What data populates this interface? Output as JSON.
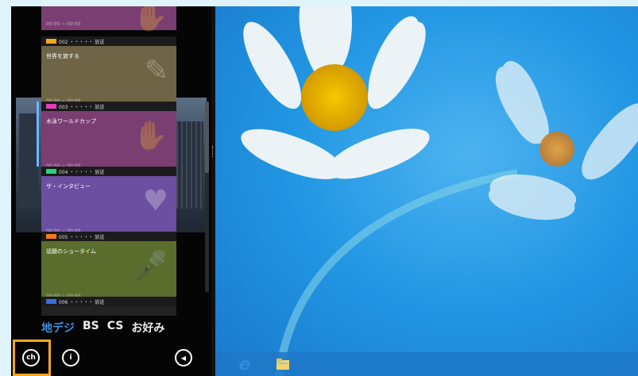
{
  "programs": [
    {
      "ch": "002 ・・・・・ 放送",
      "title": "世界を旅する",
      "time": "00:00 ~ 00:00",
      "chip": "#f5a623",
      "bg": "#6f6445",
      "glyph": "✎"
    },
    {
      "ch": "003 ・・・・・ 放送",
      "title": "水泳ワールドカップ",
      "time": "00:00 ~ 00:00",
      "chip": "#e040c0",
      "bg": "#7a3e72",
      "glyph": "✋"
    },
    {
      "ch": "004 ・・・・・ 放送",
      "title": "ザ・インタビュー",
      "time": "00:00 ~ 00:00",
      "chip": "#2bd07a",
      "bg": "#6c4fa0",
      "glyph": "♥"
    },
    {
      "ch": "005 ・・・・・ 放送",
      "title": "話題のショータイム",
      "time": "00:00 ~ 00:00",
      "chip": "#f07a1a",
      "bg": "#5a6d2c",
      "glyph": "🎤"
    },
    {
      "ch": "006 ・・・・・ 放送",
      "title": "",
      "time": "",
      "chip": "#3a6fd8",
      "bg": "#222",
      "glyph": ""
    }
  ],
  "tabs": [
    "地デジ",
    "BS",
    "CS",
    "お好み"
  ],
  "bottom": {
    "ch_label": "ch",
    "info_label": "i",
    "vol_label": "◀"
  },
  "taskbar": {
    "ie_label": "e",
    "explorer_label": "▭"
  }
}
